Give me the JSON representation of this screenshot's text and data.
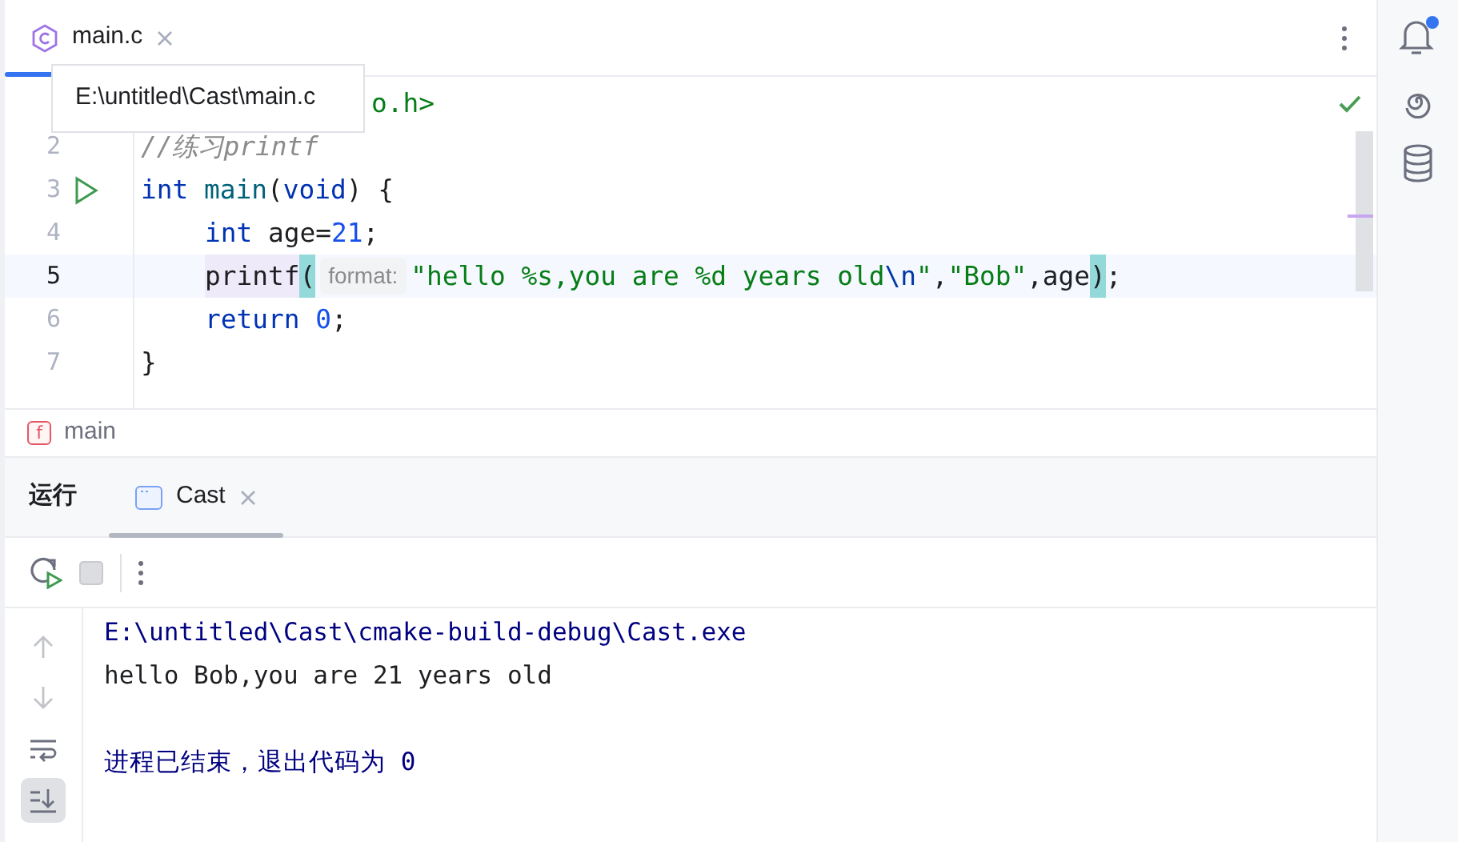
{
  "editor_tabs": [
    {
      "label": "main.c",
      "selected": true
    }
  ],
  "tooltip": {
    "text": "E:\\untitled\\Cast\\main.c"
  },
  "code_lines": [
    {
      "partly_covered": true,
      "tokens": [
        {
          "kind": "string",
          "text": "o.h>"
        }
      ]
    },
    {
      "number": "2",
      "tokens": [
        {
          "kind": "comment",
          "text": "//练习printf"
        }
      ]
    },
    {
      "number": "3",
      "run_marker": true,
      "tokens": [
        {
          "kind": "keyword",
          "text": "int "
        },
        {
          "kind": "function",
          "text": "main"
        },
        {
          "kind": "plain",
          "text": "("
        },
        {
          "kind": "keyword",
          "text": "void"
        },
        {
          "kind": "plain",
          "text": ") {"
        }
      ]
    },
    {
      "number": "4",
      "indented": true,
      "tokens": [
        {
          "kind": "keyword",
          "text": "int"
        },
        {
          "kind": "plain",
          "text": " age="
        },
        {
          "kind": "number",
          "text": "21"
        },
        {
          "kind": "plain",
          "text": ";"
        }
      ]
    },
    {
      "number": "5",
      "current": true,
      "indented": true,
      "tokens": [
        {
          "kind": "call",
          "text": "printf"
        },
        {
          "kind": "bracket_match",
          "text": "("
        },
        {
          "kind": "hint",
          "text": "format:"
        },
        {
          "kind": "string",
          "text": "\"hello %s,you are %d years old"
        },
        {
          "kind": "escape",
          "text": "\\n"
        },
        {
          "kind": "string",
          "text": "\""
        },
        {
          "kind": "plain",
          "text": ","
        },
        {
          "kind": "string",
          "text": "\"Bob\""
        },
        {
          "kind": "plain",
          "text": ",age"
        },
        {
          "kind": "bracket_match",
          "text": ")"
        },
        {
          "kind": "plain",
          "text": ";"
        }
      ]
    },
    {
      "number": "6",
      "indented": true,
      "tokens": [
        {
          "kind": "keyword",
          "text": "return "
        },
        {
          "kind": "number",
          "text": "0"
        },
        {
          "kind": "plain",
          "text": ";"
        }
      ]
    },
    {
      "number": "7",
      "tokens": [
        {
          "kind": "plain",
          "text": "}"
        }
      ]
    }
  ],
  "breadcrumb": {
    "icon_letter": "f",
    "text": "main"
  },
  "notifications": {
    "unread": true
  },
  "run_panel": {
    "title": "运行",
    "tabs": [
      {
        "label": "Cast",
        "selected": true
      }
    ],
    "toolbar": [
      {
        "kind": "rerun",
        "disabled": false
      },
      {
        "kind": "stop",
        "disabled": true
      },
      {
        "kind": "separator"
      },
      {
        "kind": "more",
        "disabled": false
      }
    ],
    "side_actions": [
      {
        "kind": "up",
        "disabled": true,
        "selected": false
      },
      {
        "kind": "down",
        "disabled": true,
        "selected": false
      },
      {
        "kind": "wrap",
        "disabled": false,
        "selected": false
      },
      {
        "kind": "scroll_end",
        "disabled": false,
        "selected": true
      }
    ],
    "console_lines": [
      {
        "kind": "command",
        "text": "E:\\untitled\\Cast\\cmake-build-debug\\Cast.exe"
      },
      {
        "kind": "output",
        "text": "hello Bob,you are 21 years old"
      },
      {
        "kind": "blank"
      },
      {
        "kind": "system",
        "text": "进程已结束，退出代码为 0"
      }
    ]
  }
}
